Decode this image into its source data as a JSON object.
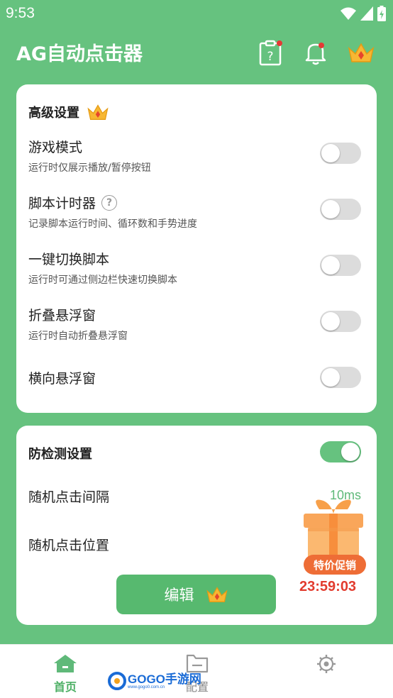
{
  "status_bar": {
    "time": "9:53"
  },
  "app_bar": {
    "title": "AG自动点击器"
  },
  "advanced": {
    "title": "高级设置",
    "rows": [
      {
        "title": "游戏模式",
        "subtitle": "运行时仅展示播放/暂停按钮",
        "enabled": false
      },
      {
        "title": "脚本计时器",
        "subtitle": "记录脚本运行时间、循环数和手势进度",
        "enabled": false,
        "help": "?"
      },
      {
        "title": "一键切换脚本",
        "subtitle": "运行时可通过侧边栏快速切换脚本",
        "enabled": false
      },
      {
        "title": "折叠悬浮窗",
        "subtitle": "运行时自动折叠悬浮窗",
        "enabled": false
      },
      {
        "title": "横向悬浮窗",
        "enabled": false
      }
    ]
  },
  "anti_detect": {
    "title": "防检测设置",
    "enabled": true,
    "random_interval_label": "随机点击间隔",
    "random_interval_value": "10ms",
    "random_position_label": "随机点击位置",
    "edit_label": "编辑"
  },
  "promo": {
    "badge": "特价促销",
    "timer": "23:59:03"
  },
  "bottom_nav": {
    "home": "首页",
    "config": "配置"
  },
  "watermark": {
    "text": "GOGO手游网",
    "url": "www.gogo0.com.cn"
  },
  "colors": {
    "brand_green": "#66c27f",
    "toggle_on": "#66c27f",
    "timer_red": "#e23b2e",
    "promo_orange": "#ee6d36"
  }
}
